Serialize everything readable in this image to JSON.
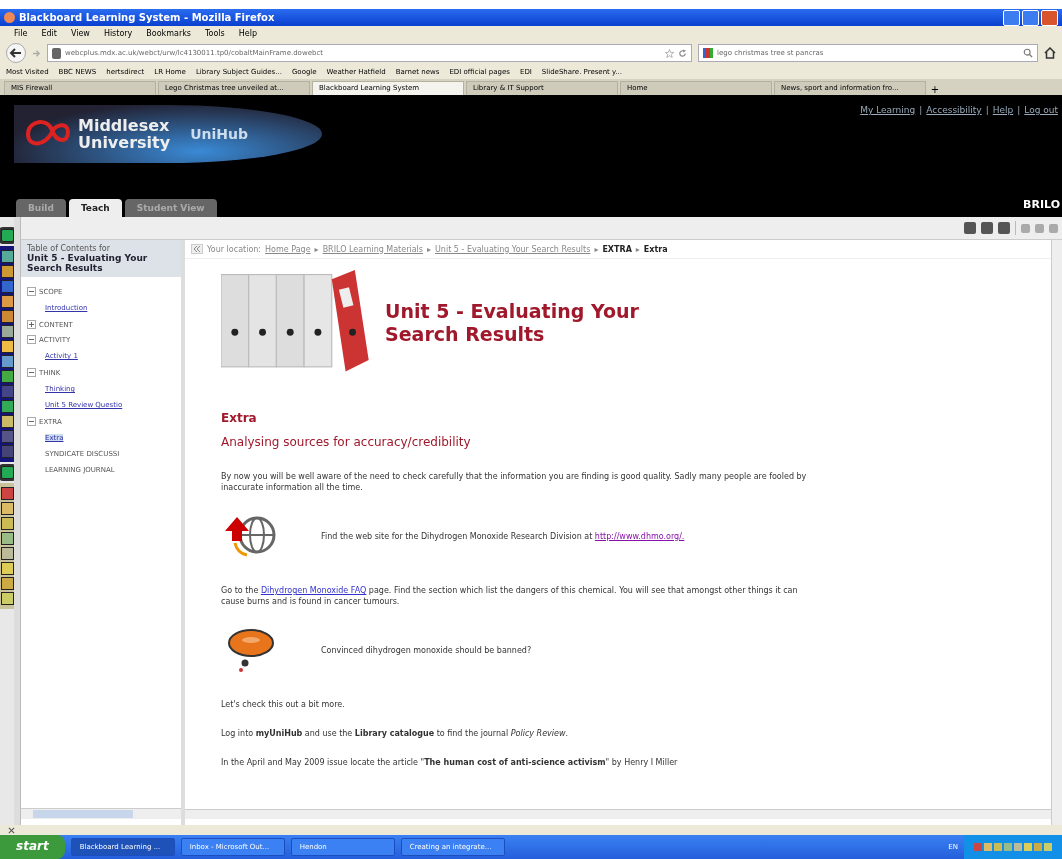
{
  "window": {
    "title": "Blackboard Learning System - Mozilla Firefox"
  },
  "menu": [
    "File",
    "Edit",
    "View",
    "History",
    "Bookmarks",
    "Tools",
    "Help"
  ],
  "address": {
    "value": "webcplus.mdx.ac.uk/webct/urw/lc4130011.tp0/cobaltMainFrame.dowebct"
  },
  "search": {
    "value": "lego christmas tree st pancras"
  },
  "bookmarks": [
    "Most Visited",
    "BBC NEWS",
    "hertsdirect",
    "LR Home",
    "Library Subject Guides...",
    "Google",
    "Weather Hatfield",
    "Barnet news",
    "EDI official pages",
    "EDI",
    "SlideShare. Present y..."
  ],
  "browser_tabs": [
    {
      "label": "MIS Firewall",
      "selected": false
    },
    {
      "label": "Lego Christmas tree unveiled at...",
      "selected": false
    },
    {
      "label": "Blackboard Learning System",
      "selected": true
    },
    {
      "label": "Library & IT Support",
      "selected": false
    },
    {
      "label": "Home",
      "selected": false
    },
    {
      "label": "News, sport and information fro...",
      "selected": false
    }
  ],
  "new_tab": "+",
  "header": {
    "logo_line1": "Middlesex",
    "logo_line2": "University",
    "product": "UniHub",
    "links": [
      "My Learning",
      "Accessibility",
      "Help",
      "Log out"
    ],
    "link_separator": "|",
    "user": "BRILO"
  },
  "course_tabs": [
    {
      "label": "Build",
      "selected": false
    },
    {
      "label": "Teach",
      "selected": true
    },
    {
      "label": "Student View",
      "selected": false
    }
  ],
  "toc": {
    "heading": "Table of Contents for",
    "title": "Unit 5 - Evaluating Your Search Results",
    "items": [
      {
        "kind": "folder",
        "label": "SCOPE",
        "expanded": true,
        "children": [
          {
            "kind": "link",
            "label": "Introduction",
            "selected": false
          }
        ]
      },
      {
        "kind": "folder",
        "label": "CONTENT",
        "expanded": false
      },
      {
        "kind": "folder",
        "label": "ACTIVITY",
        "expanded": true,
        "children": [
          {
            "kind": "link",
            "label": "Activity 1",
            "selected": false
          }
        ]
      },
      {
        "kind": "folder",
        "label": "THINK",
        "expanded": true,
        "children": [
          {
            "kind": "link",
            "label": "Thinking",
            "selected": false
          },
          {
            "kind": "link",
            "label": "Unit 5 Review Questio",
            "selected": false
          }
        ]
      },
      {
        "kind": "folder",
        "label": "EXTRA",
        "expanded": true,
        "children": [
          {
            "kind": "link",
            "label": "Extra",
            "selected": true
          },
          {
            "kind": "item",
            "label": "SYNDICATE DISCUSSI"
          },
          {
            "kind": "item",
            "label": "LEARNING JOURNAL"
          }
        ]
      }
    ]
  },
  "breadcrumb": {
    "label": "Your location:",
    "items": [
      {
        "label": "Home Page",
        "kind": "link"
      },
      {
        "label": "BRILO Learning Materials",
        "kind": "link",
        "sep": "▸"
      },
      {
        "label": "Unit 5 - Evaluating Your Search Results",
        "kind": "link",
        "sep": "▸"
      },
      {
        "label": "EXTRA",
        "kind": "current",
        "sep": "▸"
      },
      {
        "label": "Extra",
        "kind": "current",
        "sep": "▸"
      }
    ]
  },
  "page": {
    "title": "Unit 5 - Evaluating Your Search Results",
    "section": "Extra",
    "subtitle": "Analysing sources for accuracy/credibility",
    "blocks": [
      {
        "kind": "text",
        "text": "By now you will be well aware of the need to check carefully that the information you are finding is good quality. Sadly many people are fooled by inaccurate information all the time."
      },
      {
        "kind": "web",
        "before": "Find the web site for the Dihydrogen Monoxide Research Division at ",
        "link": "http://www.dhmo.org/."
      },
      {
        "kind": "link_text",
        "before": "Go to the ",
        "link": "Dihydrogen Monoxide FAQ",
        "after": " page. Find the section which list the dangers of this chemical. You will see that amongst other things it can cause burns and is found in cancer tumours."
      },
      {
        "kind": "think",
        "text": "Convinced dihydrogen monoxide should be banned?"
      },
      {
        "kind": "text",
        "text": "Let's check this out a bit more."
      },
      {
        "kind": "text",
        "text": "Log into **myUniHub** and use the **Library catalogue** to find the journal *Policy Review*."
      },
      {
        "kind": "text",
        "text": "In the April and May 2009 issue locate the article \"**The human cost of anti-science activism**\" by Henry I Miller"
      }
    ]
  },
  "taskbar": {
    "start": "start",
    "items": [
      {
        "label": "Blackboard Learning ...",
        "selected": true
      },
      {
        "label": "Inbox - Microsoft Out...",
        "selected": false
      },
      {
        "label": "Hendon",
        "selected": false
      },
      {
        "label": "Creating an integrate...",
        "selected": false
      }
    ],
    "language": "EN"
  }
}
